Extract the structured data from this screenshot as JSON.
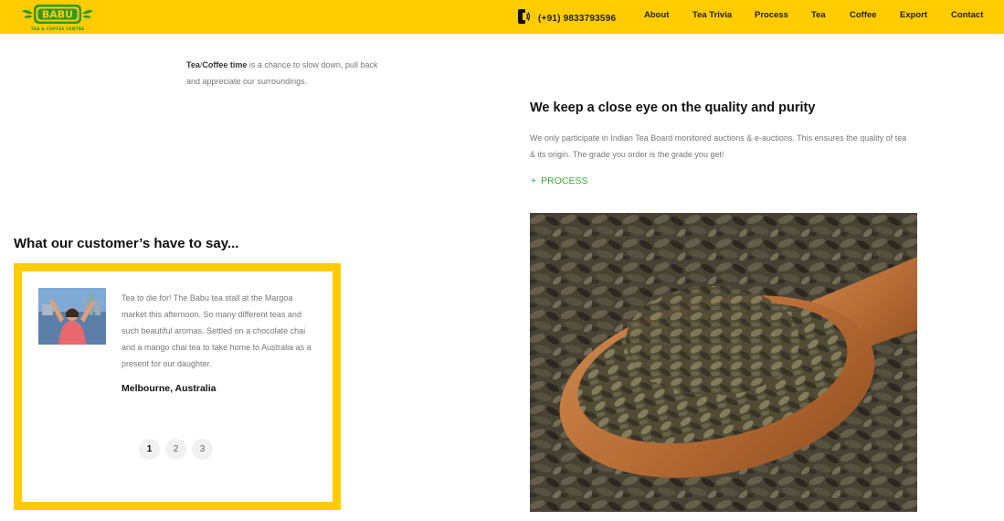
{
  "header": {
    "logo_text": "BABU",
    "logo_subtitle": "TEA & COFFEE CENTRE",
    "phone": "(+91) 9833793596",
    "nav": [
      "About",
      "Tea Trivia",
      "Process",
      "Tea",
      "Coffee",
      "Export",
      "Contact"
    ]
  },
  "quote": {
    "bold_tea": "Tea",
    "sep": "/",
    "bold_coffee": "Coffee time",
    "rest": " is a chance to slow down, pull back and appreciate our surroundings."
  },
  "testimonials": {
    "title": "What our customer’s have to say...",
    "text": "Tea to die for! The Babu tea stall at the Margoa market this afternoon. So many different teas and such beautiful aromas. Settled on a chocolate chai and a mango chai tea to take home to Australia as a present for our daughter.",
    "location": "Melbourne, Australia",
    "pages": [
      "1",
      "2",
      "3"
    ],
    "active_page": "1"
  },
  "quality": {
    "title": "We keep a close eye on the quality and purity",
    "text": "We only participate in Indian Tea Board monitored auctions & e-auctions. This ensures the quality of tea & its origin. The grade you order is the grade you get!",
    "link_plus": "+",
    "link_label": "PROCESS"
  },
  "colors": {
    "brand_yellow": "#ffcc00",
    "brand_green": "#2e9a2e",
    "link_green": "#3aa93a"
  }
}
